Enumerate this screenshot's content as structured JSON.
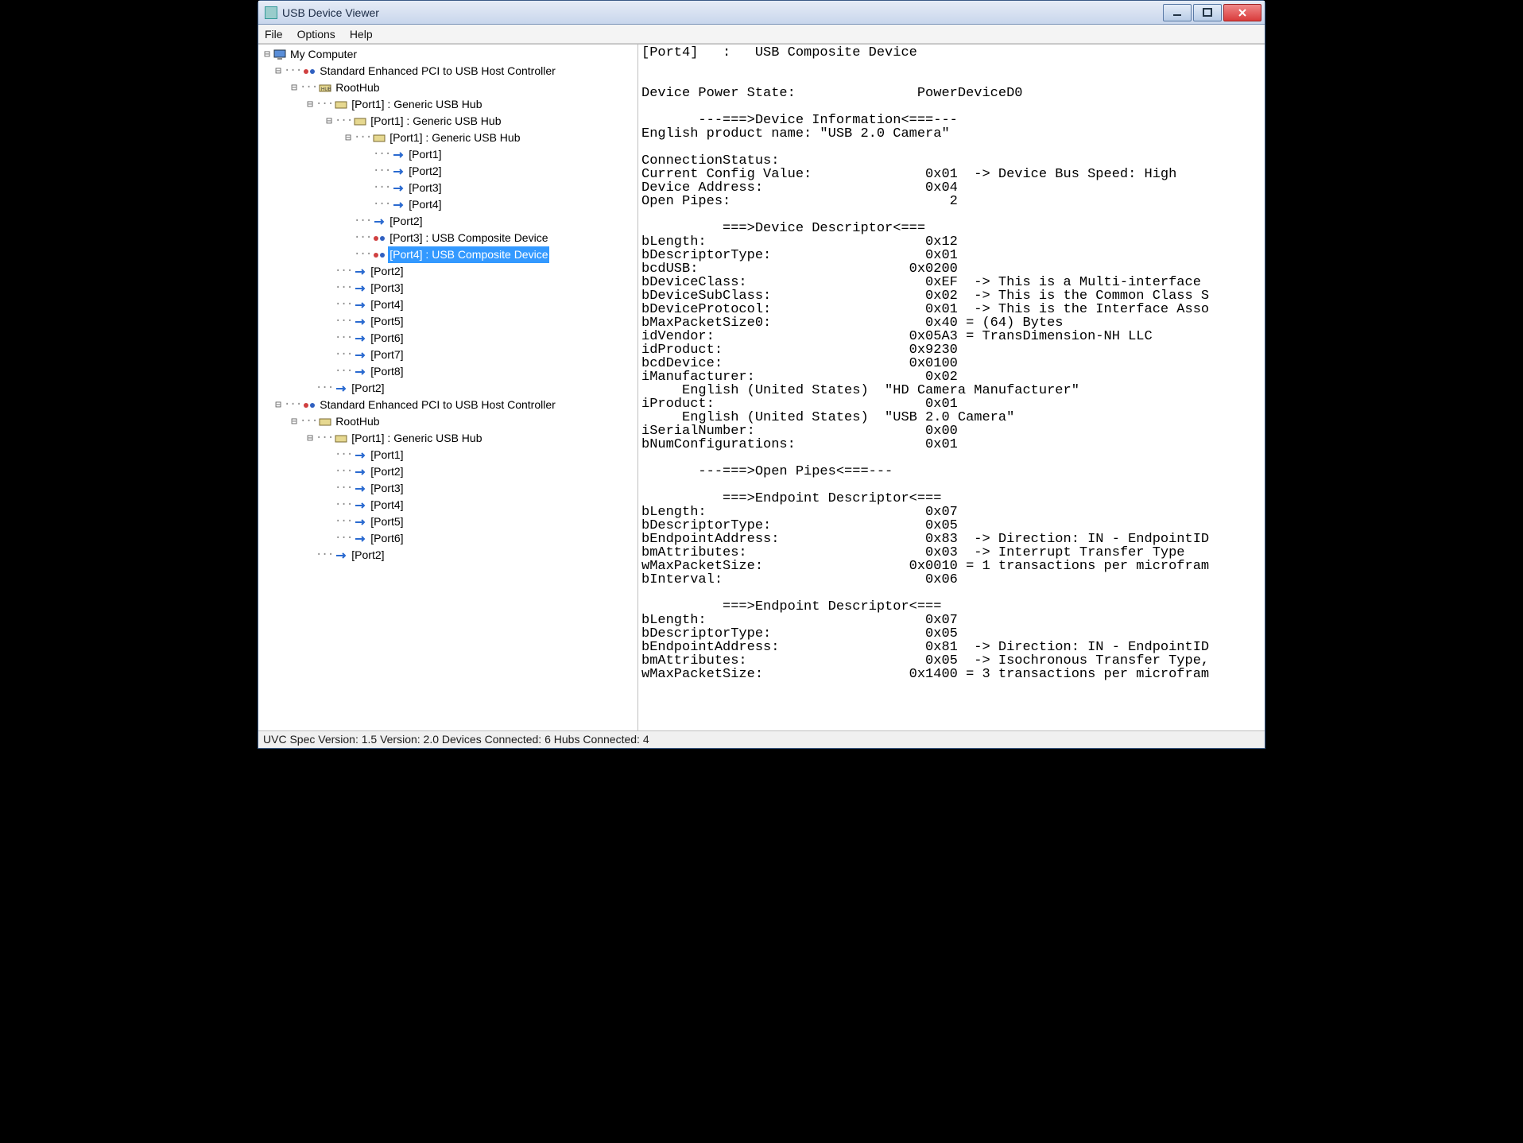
{
  "window": {
    "title": "USB Device Viewer"
  },
  "menu": {
    "file": "File",
    "options": "Options",
    "help": "Help"
  },
  "tree": {
    "root": "My Computer",
    "ctrl1": "Standard Enhanced PCI to USB Host Controller",
    "roothub": "RootHub",
    "p1_hub": "[Port1]  :  Generic USB Hub",
    "p1": "[Port1]",
    "p2": "[Port2]",
    "p3": "[Port3]",
    "p4": "[Port4]",
    "p5": "[Port5]",
    "p6": "[Port6]",
    "p7": "[Port7]",
    "p8": "[Port8]",
    "p3_comp": "[Port3]  :  USB Composite Device",
    "p4_comp": "[Port4]  :  USB Composite Device",
    "ctrl2": "Standard Enhanced PCI to USB Host Controller"
  },
  "detail": {
    "text": "[Port4]   :   USB Composite Device\n\n\nDevice Power State:               PowerDeviceD0\n\n       ---===>Device Information<===---\nEnglish product name: \"USB 2.0 Camera\"\n\nConnectionStatus:\nCurrent Config Value:              0x01  -> Device Bus Speed: High\nDevice Address:                    0x04\nOpen Pipes:                           2\n\n          ===>Device Descriptor<===\nbLength:                           0x12\nbDescriptorType:                   0x01\nbcdUSB:                          0x0200\nbDeviceClass:                      0xEF  -> This is a Multi-interface \nbDeviceSubClass:                   0x02  -> This is the Common Class S\nbDeviceProtocol:                   0x01  -> This is the Interface Asso\nbMaxPacketSize0:                   0x40 = (64) Bytes\nidVendor:                        0x05A3 = TransDimension-NH LLC\nidProduct:                       0x9230\nbcdDevice:                       0x0100\niManufacturer:                     0x02\n     English (United States)  \"HD Camera Manufacturer\"\niProduct:                          0x01\n     English (United States)  \"USB 2.0 Camera\"\niSerialNumber:                     0x00\nbNumConfigurations:                0x01\n\n       ---===>Open Pipes<===---\n\n          ===>Endpoint Descriptor<===\nbLength:                           0x07\nbDescriptorType:                   0x05\nbEndpointAddress:                  0x83  -> Direction: IN - EndpointID\nbmAttributes:                      0x03  -> Interrupt Transfer Type\nwMaxPacketSize:                  0x0010 = 1 transactions per microfram\nbInterval:                         0x06\n\n          ===>Endpoint Descriptor<===\nbLength:                           0x07\nbDescriptorType:                   0x05\nbEndpointAddress:                  0x81  -> Direction: IN - EndpointID\nbmAttributes:                      0x05  -> Isochronous Transfer Type,\nwMaxPacketSize:                  0x1400 = 3 transactions per microfram\n"
  },
  "status": "UVC Spec Version: 1.5 Version: 2.0 Devices Connected: 6   Hubs Connected: 4"
}
